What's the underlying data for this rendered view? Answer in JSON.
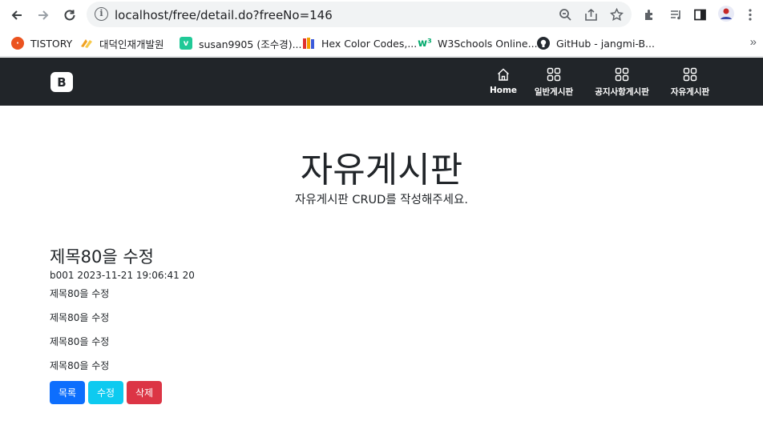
{
  "browser": {
    "url": "localhost/free/detail.do?freeNo=146",
    "bookmarks": [
      {
        "label": "TISTORY",
        "icon": "tistory-icon",
        "color": "#eb531f"
      },
      {
        "label": "대덕인재개발원",
        "icon": "ddit-icon",
        "color": "#f0a020"
      },
      {
        "label": "susan9905 (조수경)...",
        "icon": "velog-icon",
        "color": "#20c997"
      },
      {
        "label": "Hex Color Codes,...",
        "icon": "books-icon",
        "color": "#3b5bdb"
      },
      {
        "label": "W3Schools Online...",
        "icon": "w3schools-icon",
        "color": "#04aa6d"
      },
      {
        "label": "GitHub - jangmi-B...",
        "icon": "github-icon",
        "color": "#24292f"
      }
    ]
  },
  "navbar": {
    "brand": "B",
    "items": [
      {
        "label": "Home",
        "icon": "house-icon"
      },
      {
        "label": "일반게시판",
        "icon": "grid-icon"
      },
      {
        "label": "공지사항게시판",
        "icon": "grid-icon"
      },
      {
        "label": "자유게시판",
        "icon": "grid-icon"
      }
    ]
  },
  "hero": {
    "title": "자유게시판",
    "subtitle": "자유게시판 CRUD를 작성해주세요."
  },
  "post": {
    "title": "제목80을 수정",
    "meta": "b001 2023-11-21 19:06:41 20",
    "lines": [
      "제목80을 수정",
      "제목80을 수정",
      "제목80을 수정",
      "제목80을 수정"
    ]
  },
  "buttons": {
    "list": "목록",
    "edit": "수정",
    "delete": "삭제"
  },
  "colors": {
    "navbar_bg": "#212529",
    "btn_primary": "#0d6efd",
    "btn_info": "#0dcaf0",
    "btn_danger": "#dc3545"
  }
}
